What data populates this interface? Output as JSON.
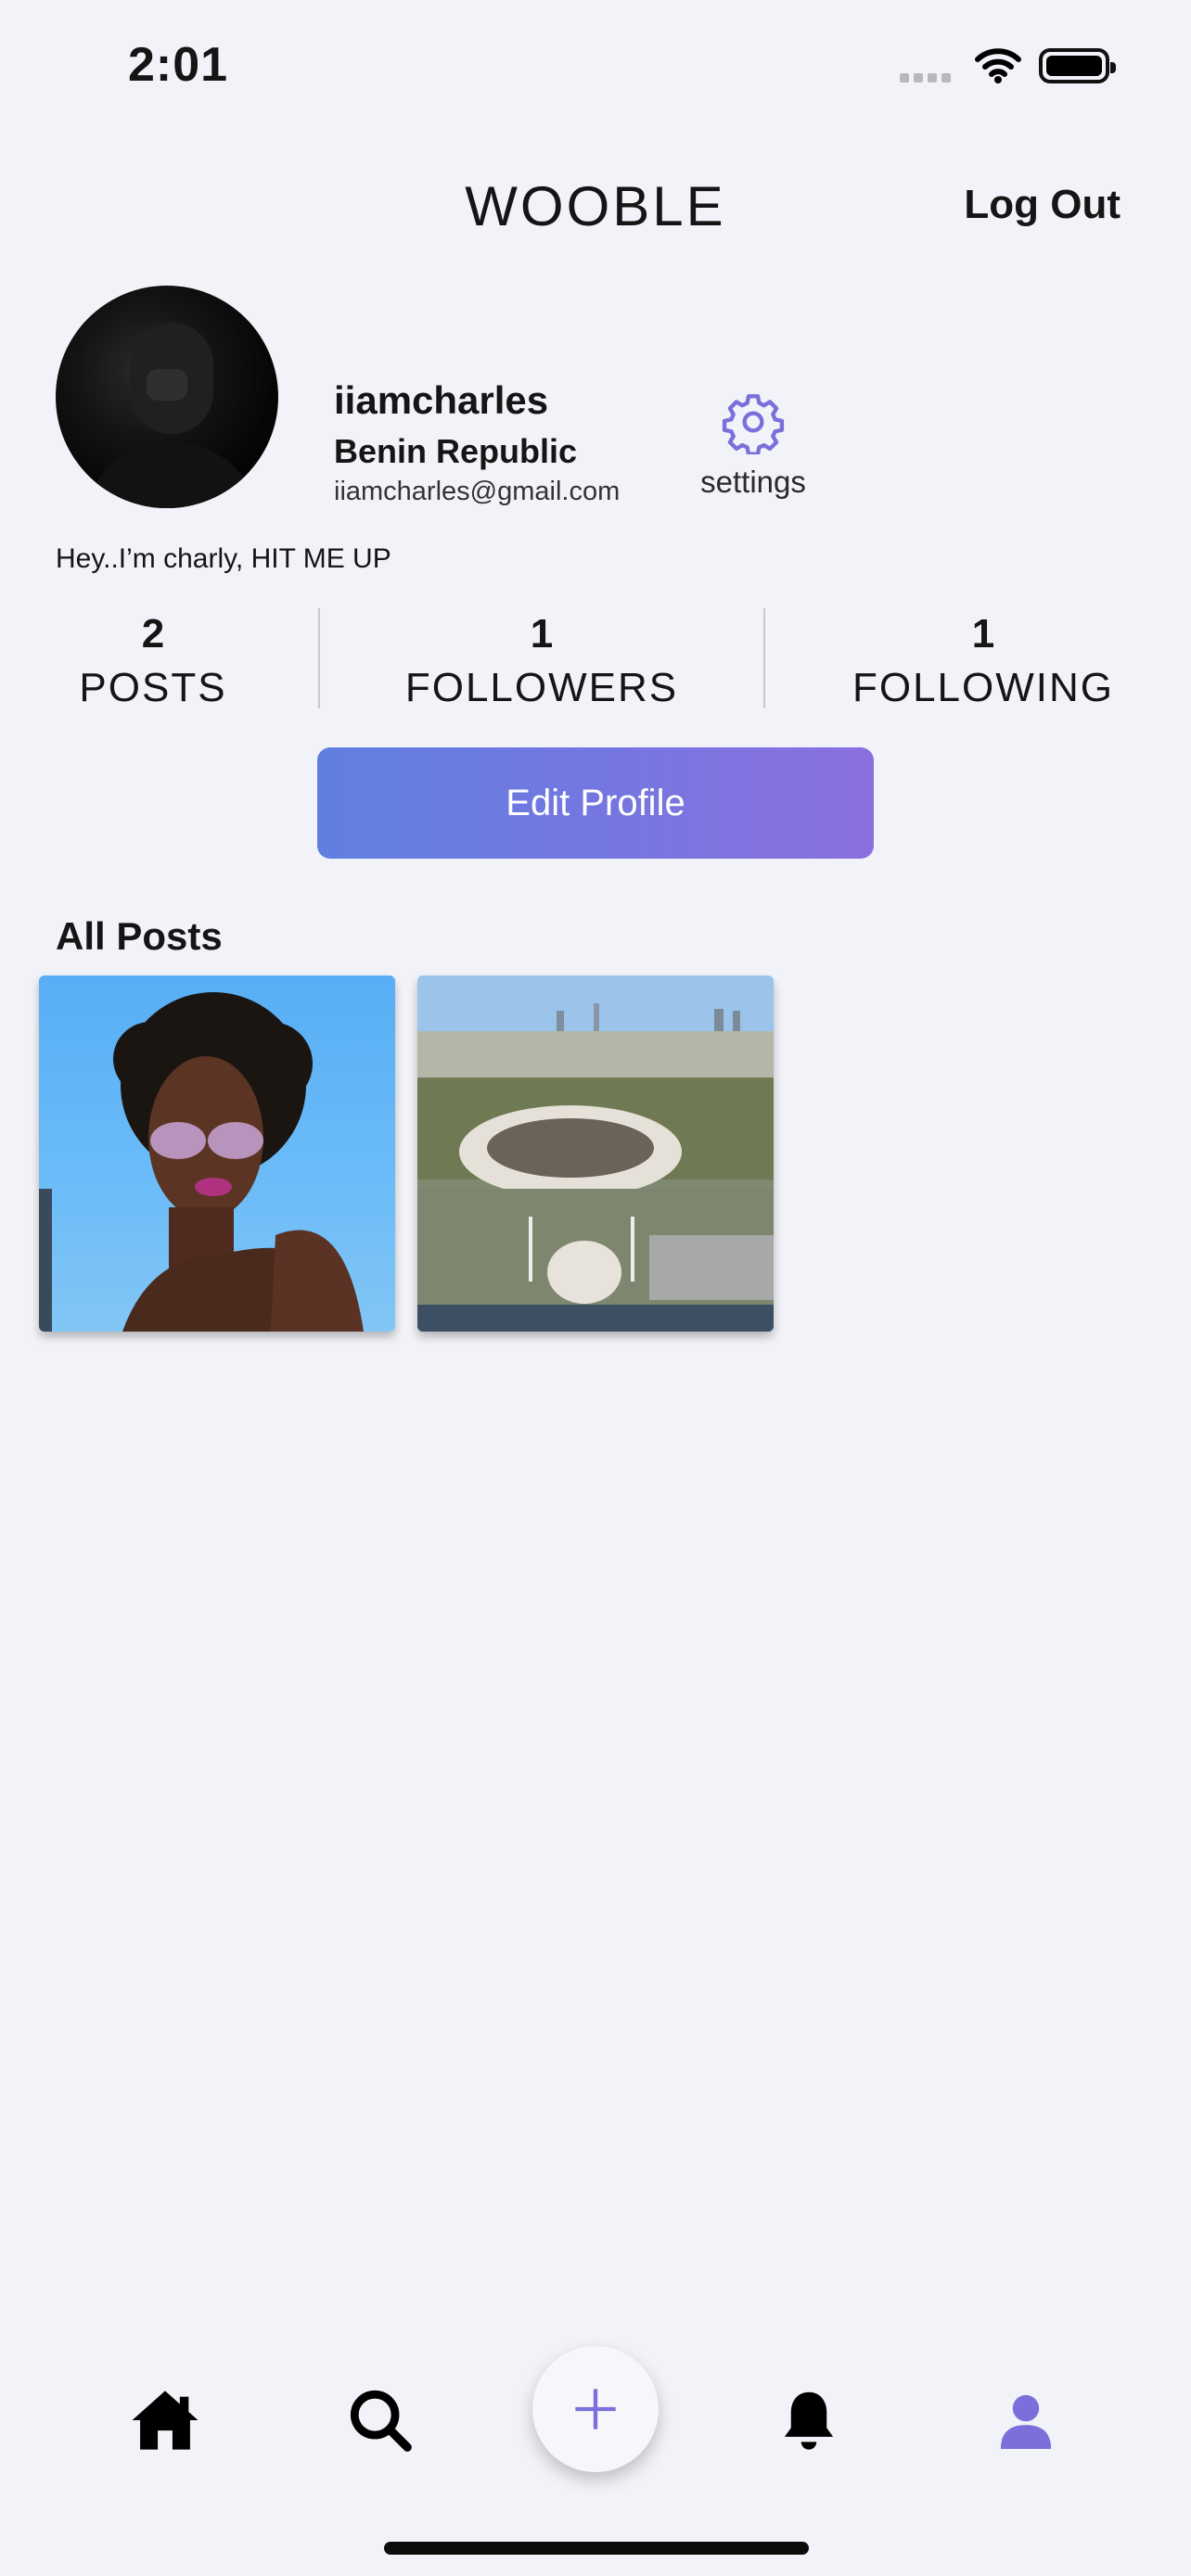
{
  "status_bar": {
    "time": "2:01"
  },
  "header": {
    "title": "WOOBLE",
    "logout_label": "Log Out"
  },
  "profile": {
    "username": "iiamcharles",
    "location": "Benin Republic",
    "email": "iiamcharles@gmail.com",
    "settings_label": "settings",
    "bio": "Hey..I’m charly, HIT ME UP"
  },
  "stats": [
    {
      "value": "2",
      "label": "POSTS"
    },
    {
      "value": "1",
      "label": "FOLLOWERS"
    },
    {
      "value": "1",
      "label": "FOLLOWING"
    }
  ],
  "edit_profile_label": "Edit Profile",
  "posts_section": {
    "title": "All Posts"
  },
  "posts": [
    {
      "icon": "portrait-photo"
    },
    {
      "icon": "city-stadium-photo"
    }
  ],
  "tab_bar": {
    "items": [
      "home-icon",
      "search-icon",
      "add-icon",
      "bell-icon",
      "profile-icon"
    ],
    "active": "profile-icon"
  },
  "colors": {
    "accent": "#7b6fdc",
    "button_gradient_start": "#5f7fe0",
    "button_gradient_end": "#8a6fe0",
    "background": "#f2f3f8"
  }
}
